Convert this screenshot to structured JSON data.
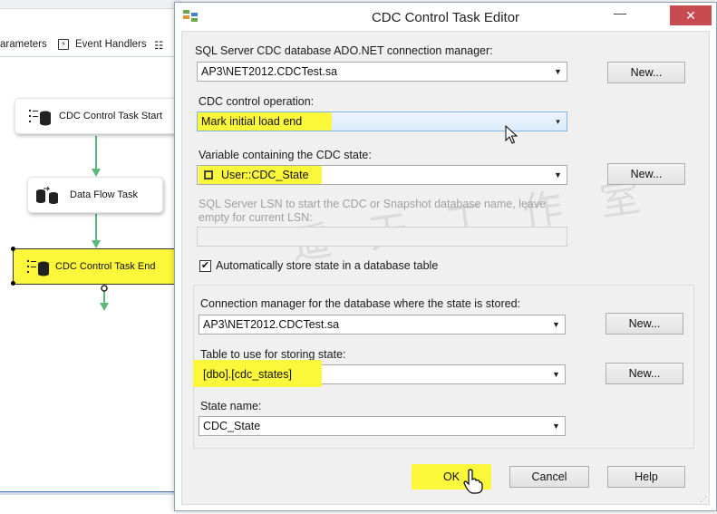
{
  "designer": {
    "tabs": {
      "parameters": "arameters",
      "event_handlers": "Event Handlers"
    },
    "tasks": {
      "start": "CDC Control Task Start",
      "data_flow": "Data Flow Task",
      "end": "CDC Control Task End"
    }
  },
  "dialog": {
    "title": "CDC Control Task Editor",
    "min_glyph": "—",
    "close_glyph": "✕",
    "connection_manager": {
      "label": "SQL Server CDC database ADO.NET connection manager:",
      "value": "AP3\\NET2012.CDCTest.sa",
      "new_label": "New..."
    },
    "operation": {
      "label": "CDC control operation:",
      "value": "Mark initial load end"
    },
    "state_variable": {
      "label": "Variable containing the CDC state:",
      "value": "User::CDC_State",
      "new_label": "New..."
    },
    "lsn": {
      "label_line1": "SQL Server LSN to start the CDC or Snapshot database name, leave",
      "label_line2": "empty for current LSN:",
      "value": ""
    },
    "auto_store": {
      "label": "Automatically store state in a database table",
      "checked": true,
      "check_glyph": "✔"
    },
    "state_connection": {
      "label": "Connection manager for the database where the state is stored:",
      "value": "AP3\\NET2012.CDCTest.sa",
      "new_label": "New..."
    },
    "state_table": {
      "label": "Table to use for storing state:",
      "value": "[dbo].[cdc_states]",
      "new_label": "New..."
    },
    "state_name": {
      "label": "State name:",
      "value": "CDC_State"
    },
    "buttons": {
      "ok": "OK",
      "cancel": "Cancel",
      "help": "Help"
    },
    "watermark": "遥 天 工 作 室"
  },
  "colors": {
    "highlight": "#fbf73a",
    "close": "#c74b50",
    "flow_arrow": "#5cb87a"
  },
  "icons": [
    "cdc-task-icon",
    "data-flow-icon",
    "event-handlers-icon",
    "editor-app-icon",
    "dropdown-arrow-icon",
    "mouse-pointer-icon",
    "hand-cursor-icon"
  ]
}
